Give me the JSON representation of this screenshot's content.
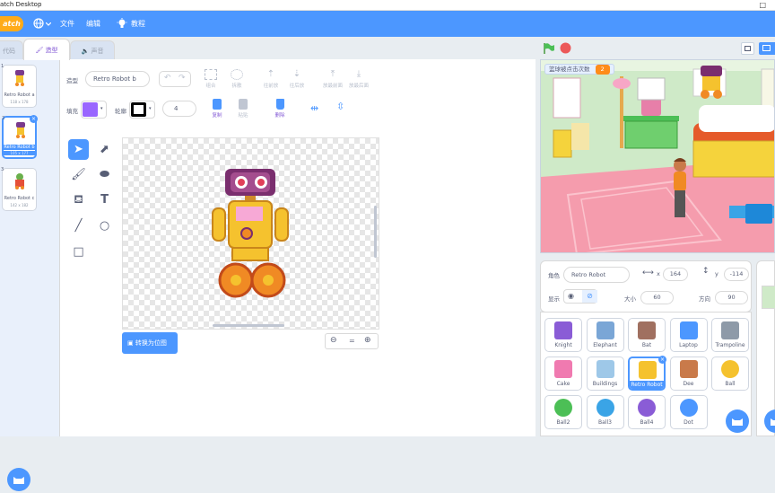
{
  "window": {
    "title": "atch Desktop",
    "max_icon": "□"
  },
  "menubar": {
    "logo_text": "atch",
    "globe_icon": "globe-icon",
    "file": "文件",
    "edit": "编辑",
    "tutorials": "教程"
  },
  "tabs": {
    "code": "代码",
    "costumes": "造型",
    "sounds": "声音"
  },
  "costumes": [
    {
      "num": "1",
      "name": "Retro Robot a",
      "size": "118 x 178"
    },
    {
      "num": "2",
      "name": "Retro Robot b",
      "size": "105 x 177"
    },
    {
      "num": "3",
      "name": "Retro Robot c",
      "size": "142 x 182"
    }
  ],
  "editor": {
    "costume_label": "造型",
    "costume_name": "Retro Robot b",
    "fill_label": "填充",
    "outline_label": "轮廓",
    "outline_width": "4",
    "fill_color": "#9966ff",
    "outline_color": "#000000",
    "toolbar": {
      "group": "组合",
      "ungroup": "拆散",
      "forward": "往前放",
      "backward": "往后放",
      "front": "放最前面",
      "back": "放最后面",
      "copy": "复制",
      "paste": "粘贴",
      "delete": "删除"
    },
    "convert_button": "转换为位图",
    "zoom_reset": "="
  },
  "stage": {
    "variable_name": "篮球被点击次数",
    "variable_value": "2"
  },
  "sprite_info": {
    "sprite_label": "角色",
    "sprite_name": "Retro Robot",
    "x_label": "x",
    "x_value": "164",
    "y_label": "y",
    "y_value": "-114",
    "show_label": "显示",
    "size_label": "大小",
    "size_value": "60",
    "direction_label": "方向",
    "direction_value": "90"
  },
  "sprites": [
    {
      "name": "Knight"
    },
    {
      "name": "Elephant"
    },
    {
      "name": "Bat"
    },
    {
      "name": "Laptop"
    },
    {
      "name": "Trampoline"
    },
    {
      "name": "Cake"
    },
    {
      "name": "Buildings"
    },
    {
      "name": "Retro Robot"
    },
    {
      "name": "Dee"
    },
    {
      "name": "Ball"
    },
    {
      "name": "Ball2"
    },
    {
      "name": "Ball3"
    },
    {
      "name": "Ball4"
    },
    {
      "name": "Dot"
    }
  ],
  "colors": {
    "accent": "#4c97ff",
    "purple": "#855cd6",
    "menubar": "#4c97ff"
  }
}
